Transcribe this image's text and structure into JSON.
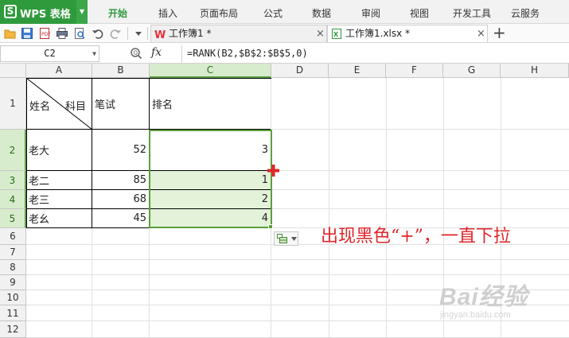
{
  "app": {
    "logo": "S",
    "title": "WPS 表格",
    "dropdown_icon": "caret-down-icon"
  },
  "menu": {
    "items": [
      "开始",
      "插入",
      "页面布局",
      "公式",
      "数据",
      "审阅",
      "视图",
      "开发工具",
      "云服务"
    ],
    "active_index": 0
  },
  "toolbar": {
    "icons": [
      "open-folder-icon",
      "save-icon",
      "export-pdf-icon",
      "print-icon",
      "print-preview-icon",
      "undo-icon",
      "redo-icon",
      "customize-dropdown-icon"
    ],
    "tabs": [
      {
        "label": "工作簿1 *",
        "icon": "wps-doc-icon",
        "active": false
      },
      {
        "label": "工作簿1.xlsx *",
        "icon": "excel-doc-icon",
        "active": true
      }
    ],
    "close_glyph": "×",
    "new_tab_glyph": "+"
  },
  "formula_bar": {
    "cell_ref": "C2",
    "fx_label": "fx",
    "formula": "=RANK(B2,$B$2:$B$5,0)"
  },
  "grid": {
    "columns": [
      "A",
      "B",
      "C",
      "D",
      "E",
      "F",
      "G",
      "H"
    ],
    "rows": [
      "1",
      "2",
      "3",
      "4",
      "5",
      "6",
      "7",
      "8",
      "9",
      "10",
      "11",
      "12"
    ],
    "selected_column": "C",
    "selected_rows": [
      "2",
      "3",
      "4",
      "5"
    ],
    "header": {
      "a_left": "姓名",
      "a_right": "科目",
      "b": "笔试",
      "c": "排名"
    },
    "data": [
      {
        "name": "老大",
        "score": "52",
        "rank": "3"
      },
      {
        "name": "老二",
        "score": "85",
        "rank": "1"
      },
      {
        "name": "老三",
        "score": "68",
        "rank": "2"
      },
      {
        "name": "老幺",
        "score": "45",
        "rank": "4"
      }
    ]
  },
  "annotation": "出现黑色“+”，一直下拉",
  "watermark": {
    "text": "Bai经验",
    "sub": "jingyan.baidu.com"
  },
  "colors": {
    "accent": "#2f9a3c",
    "selection": "#5aa03a",
    "highlight": "#e3f2d9",
    "annotation": "#e0262b"
  }
}
